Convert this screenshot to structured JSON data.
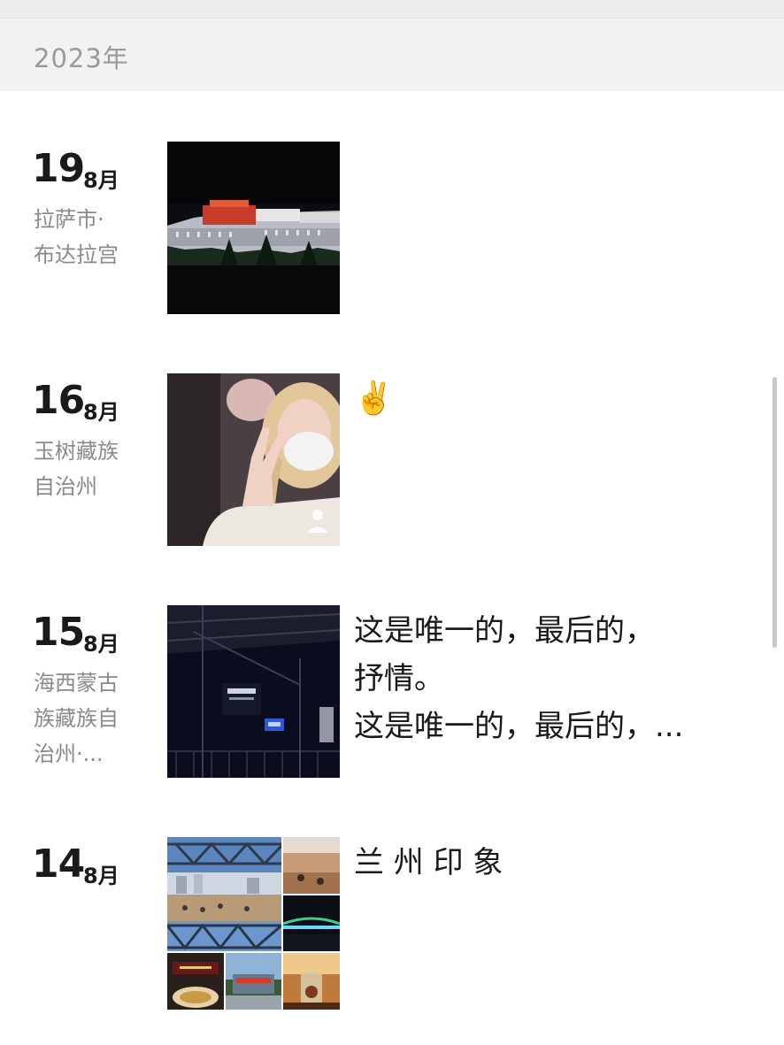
{
  "year_header": {
    "label": "2023年"
  },
  "entries": [
    {
      "day": "19",
      "month": "8月",
      "location": [
        "拉萨市·",
        "布达拉宫"
      ],
      "caption": ""
    },
    {
      "day": "16",
      "month": "8月",
      "location": [
        "玉树藏族",
        "自治州"
      ],
      "caption": "✌️"
    },
    {
      "day": "15",
      "month": "8月",
      "location": [
        "海西蒙古",
        "族藏族自",
        "治州·..."
      ],
      "caption_lines": [
        "这是唯一的，最后的，",
        "抒情。",
        "这是唯一的，最后的，..."
      ]
    },
    {
      "day": "14",
      "month": "8月",
      "location": [],
      "caption": "兰 州 印 象"
    }
  ],
  "colors": {
    "header_bg": "#f2f2f2",
    "text_primary": "#1a1a1a",
    "text_secondary": "#8a8a8a"
  }
}
